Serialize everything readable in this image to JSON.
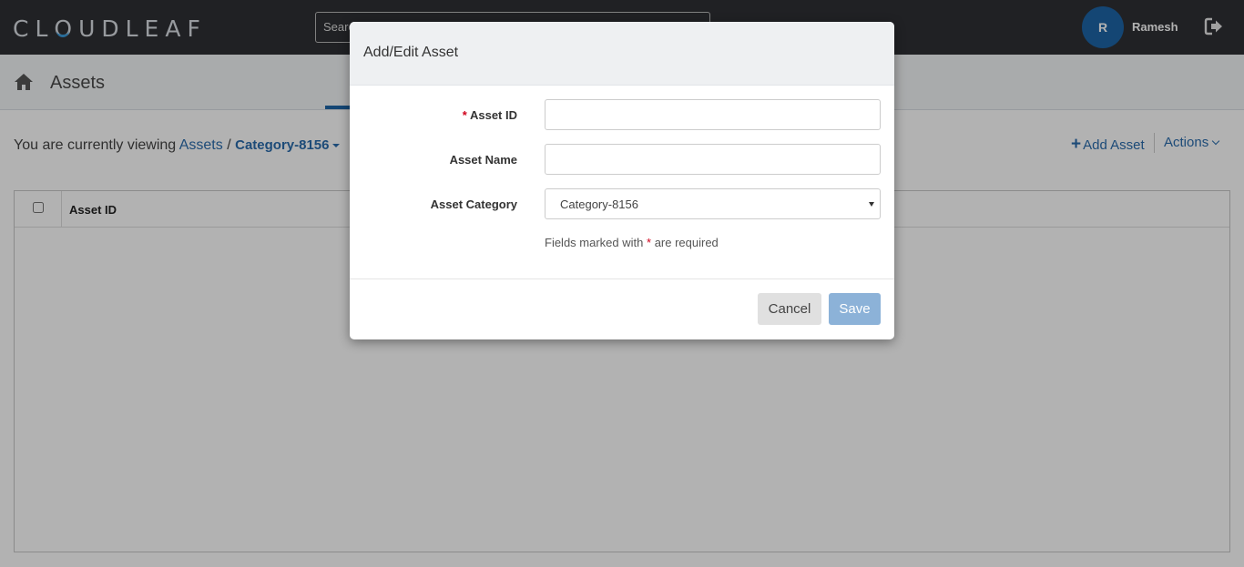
{
  "header": {
    "logo_before": "CL",
    "logo_o": "O",
    "logo_after": "UDLEAF",
    "search_placeholder": "Search",
    "user_initial": "R",
    "user_name": "Ramesh"
  },
  "subheader": {
    "title": "Assets"
  },
  "breadcrumb": {
    "prefix": "You are currently viewing",
    "root": "Assets",
    "separator": "/",
    "current": "Category-8156"
  },
  "toolbar": {
    "add_asset_icon": "+",
    "add_asset_label": "Add Asset",
    "actions_label": "Actions"
  },
  "grid": {
    "columns": [
      "Asset ID"
    ]
  },
  "modal": {
    "title": "Add/Edit Asset",
    "fields": {
      "asset_id_label": "Asset ID",
      "asset_id_value": "",
      "asset_name_label": "Asset Name",
      "asset_name_value": "",
      "asset_category_label": "Asset Category",
      "asset_category_value": "Category-8156"
    },
    "required_marker": "*",
    "note_prefix": "Fields marked with",
    "note_suffix": "are required",
    "cancel_label": "Cancel",
    "save_label": "Save"
  },
  "colors": {
    "topbar": "#2f3034",
    "accent": "#1d65a6",
    "link": "#2a6cad",
    "required": "#d0021b",
    "save_button": "#8cb2d8"
  },
  "icons": {
    "home": "home-icon",
    "logout": "logout-icon",
    "caret": "caret-down-icon",
    "chevron": "chevron-down-icon"
  }
}
